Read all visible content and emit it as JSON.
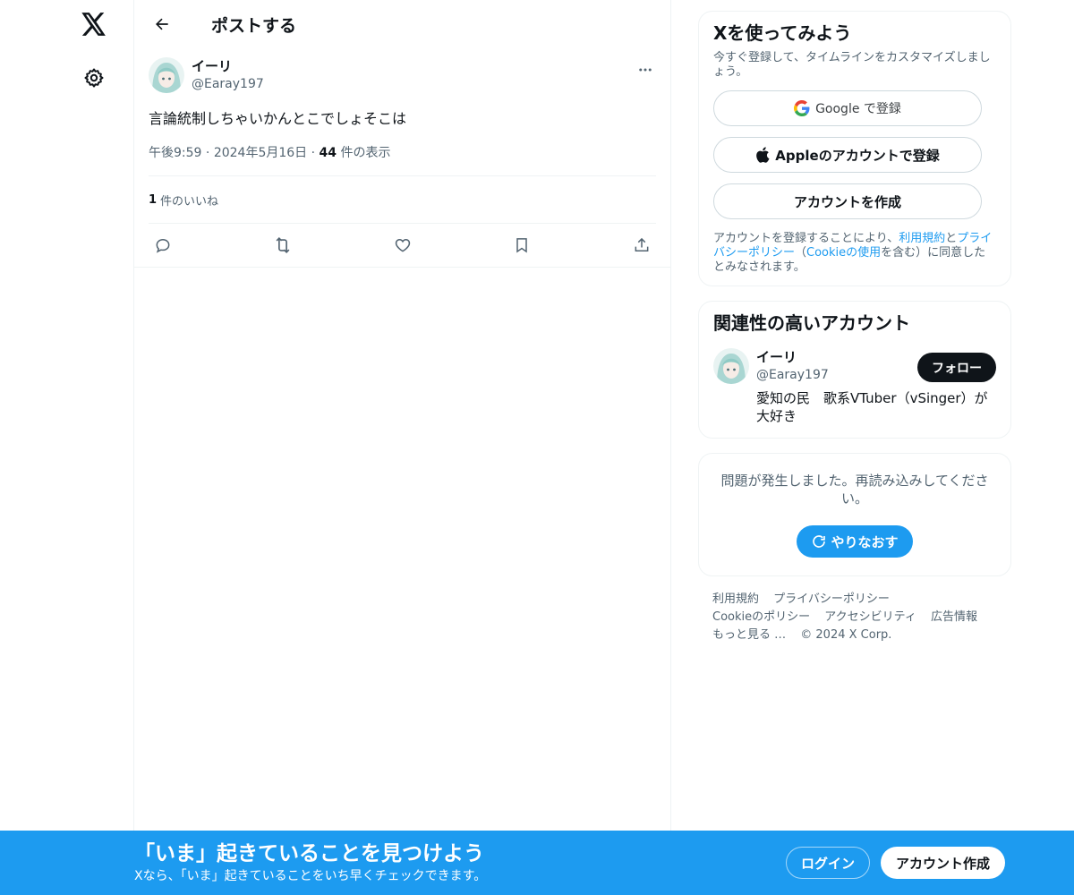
{
  "header": {
    "title": "ポストする"
  },
  "post": {
    "author_name": "イーリ",
    "author_handle": "@Earay197",
    "text": "言論統制しちゃいかんとこでしょそこは",
    "time": "午後9:59",
    "date": "2024年5月16日",
    "views_count": "44",
    "views_label": "件の表示",
    "likes_count": "1",
    "likes_label": "件のいいね"
  },
  "signup": {
    "title": "Xを使ってみよう",
    "subtitle": "今すぐ登録して、タイムラインをカスタマイズしましょう。",
    "google_label": "Google で登録",
    "apple_label": "Appleのアカウントで登録",
    "create_label": "アカウントを作成",
    "terms_prefix": "アカウントを登録することにより、",
    "terms_link": "利用規約",
    "terms_and": "と",
    "privacy_link": "プライバシーポリシー",
    "terms_paren_open": "（",
    "cookie_link": "Cookieの使用",
    "terms_suffix": "を含む）に同意したとみなされます。"
  },
  "related": {
    "title": "関連性の高いアカウント",
    "name": "イーリ",
    "handle": "@Earay197",
    "follow_label": "フォロー",
    "bio": "愛知の民　歌系VTuber（vSinger）が大好き"
  },
  "error": {
    "text": "問題が発生しました。再読み込みしてください。",
    "retry_label": "やりなおす"
  },
  "footer": {
    "links": [
      "利用規約",
      "プライバシーポリシー",
      "Cookieのポリシー",
      "アクセシビリティ",
      "広告情報",
      "もっと見る …"
    ],
    "copyright": "© 2024 X Corp."
  },
  "banner": {
    "title": "「いま」起きていることを見つけよう",
    "subtitle": "Xなら、「いま」起きていることをいち早くチェックできます。",
    "login_label": "ログイン",
    "create_label": "アカウント作成"
  },
  "colors": {
    "accent": "#1d9bf0",
    "text": "#0f1419",
    "muted": "#536471",
    "border": "#eff3f4"
  },
  "icons": [
    "x-logo-icon",
    "gear-icon",
    "back-arrow-icon",
    "more-icon",
    "reply-icon",
    "repost-icon",
    "like-icon",
    "bookmark-icon",
    "share-icon",
    "google-icon",
    "apple-icon",
    "refresh-icon"
  ]
}
